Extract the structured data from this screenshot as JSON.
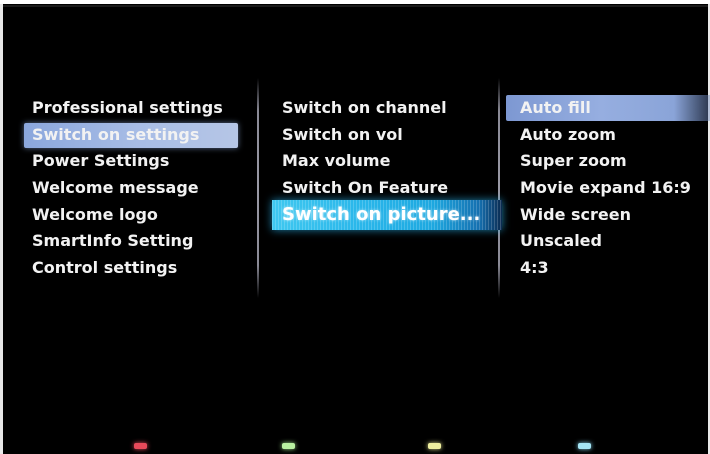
{
  "menu": {
    "level1": {
      "selected_index": 1,
      "items": [
        "Professional settings",
        "Switch on settings",
        "Power Settings",
        "Welcome message",
        "Welcome logo",
        "SmartInfo Setting",
        "Control settings"
      ]
    },
    "level2": {
      "focused_index": 4,
      "items": [
        "Switch on channel",
        "Switch on vol",
        "Max volume",
        "Switch On Feature",
        "Switch on picture..."
      ]
    },
    "level3": {
      "selected_index": 0,
      "items": [
        "Auto fill",
        "Auto zoom",
        "Super zoom",
        "Movie expand 16:9",
        "Wide screen",
        "Unscaled",
        "4:3"
      ]
    }
  },
  "color_keys": [
    {
      "name": "red",
      "color": "#e84a5a"
    },
    {
      "name": "green",
      "color": "#b8f0a0"
    },
    {
      "name": "yellow",
      "color": "#f0f0a0"
    },
    {
      "name": "blue",
      "color": "#a6e6f6"
    }
  ]
}
